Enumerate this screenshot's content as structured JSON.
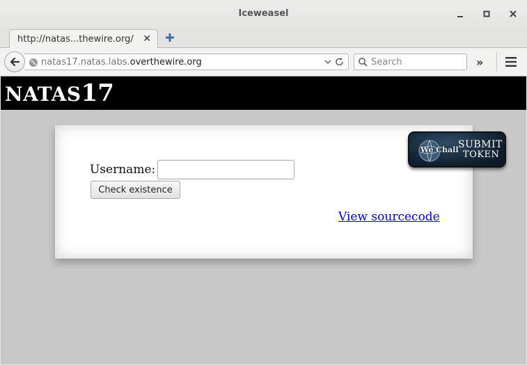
{
  "window": {
    "title": "Iceweasel"
  },
  "tabs": [
    {
      "label": "http://natas...thewire.org/"
    }
  ],
  "navbar": {
    "url_prefix": "natas17.natas.labs.",
    "url_host": "overthewire.org",
    "search_placeholder": "Search",
    "overflow_glyph": "»"
  },
  "page": {
    "logo_prefix": "NATAS",
    "logo_number": "17",
    "username_label": "Username:",
    "username_value": "",
    "check_button": "Check existence",
    "view_source_link": "View sourcecode",
    "wechall": {
      "brand": "We Chall",
      "line1": "SUBMIT",
      "line2": "TOKEN"
    }
  },
  "colors": {
    "header_bg": "#000000",
    "page_bg": "#c8c8c8",
    "link": "#0000cc",
    "badge_bg": "#1b3147"
  }
}
